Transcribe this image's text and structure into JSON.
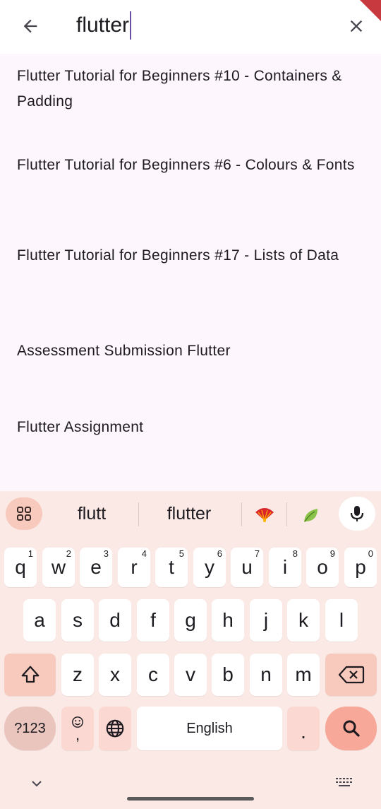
{
  "search": {
    "query": "flutter"
  },
  "results": [
    "Flutter Tutorial for Beginners #10 - Containers & Padding",
    "Flutter Tutorial for Beginners #6 - Colours & Fonts",
    "Flutter Tutorial for Beginners #17 - Lists of Data",
    "Assessment Submission Flutter",
    "Flutter Assignment"
  ],
  "keyboard": {
    "suggestions": [
      "flutt",
      "flutter"
    ],
    "emoji_suggestions": [
      "fan-emoji",
      "leaf-emoji"
    ],
    "row1": [
      {
        "k": "q",
        "h": "1"
      },
      {
        "k": "w",
        "h": "2"
      },
      {
        "k": "e",
        "h": "3"
      },
      {
        "k": "r",
        "h": "4"
      },
      {
        "k": "t",
        "h": "5"
      },
      {
        "k": "y",
        "h": "6"
      },
      {
        "k": "u",
        "h": "7"
      },
      {
        "k": "i",
        "h": "8"
      },
      {
        "k": "o",
        "h": "9"
      },
      {
        "k": "p",
        "h": "0"
      }
    ],
    "row2": [
      "a",
      "s",
      "d",
      "f",
      "g",
      "h",
      "j",
      "k",
      "l"
    ],
    "row3": [
      "z",
      "x",
      "c",
      "v",
      "b",
      "n",
      "m"
    ],
    "num_label": "?123",
    "comma_label": ",",
    "space_label": "English",
    "period_label": ".",
    "colors": {
      "accent": "#f8a898",
      "key_bg": "#ffffff",
      "keyboard_bg": "#fbe9e5"
    }
  }
}
